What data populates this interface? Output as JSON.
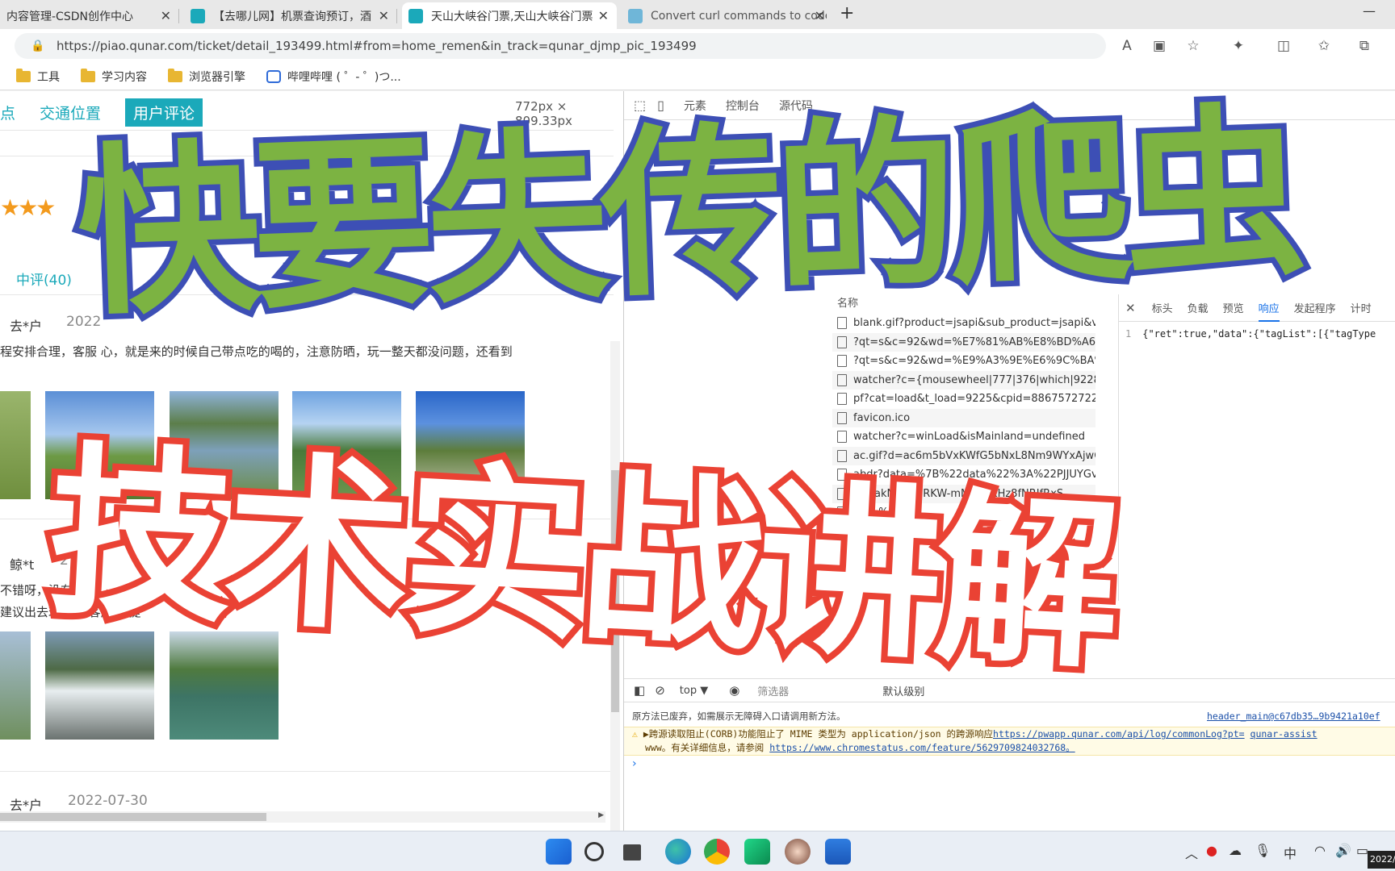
{
  "tabs": [
    {
      "title": "内容管理-CSDN创作中心",
      "close": "✕"
    },
    {
      "title": "【去哪儿网】机票查询预订，酒",
      "close": "✕"
    },
    {
      "title": "天山大峡谷门票,天山大峡谷门票",
      "close": "✕"
    },
    {
      "title": "Convert curl commands to code",
      "close": "✕"
    }
  ],
  "new_tab": "+",
  "window_minimize": "—",
  "address": {
    "url": "https://piao.qunar.com/ticket/detail_193499.html#from=home_remen&in_track=qunar_djmp_pic_193499"
  },
  "bookmarks": [
    "工具",
    "学习内容",
    "浏览器引擎",
    "哔哩哔哩 ( ゜- ゜)つ..."
  ],
  "page": {
    "nav": [
      "点",
      "交通位置",
      "用户评论"
    ],
    "dimensions": "772px × 809.33px",
    "stars": "★★★",
    "filter_label": "中评(40)",
    "reviews": [
      {
        "user": "去*户",
        "date": "2022",
        "text": "程安排合理，客服      心，就是来的时候自己带点吃的喝的，注意防晒，玩一整天都没问题，还看到"
      },
      {
        "user": "鲸*t",
        "date": "2",
        "text1": "不错呀，没有",
        "text2": "建议出去玩的时        客服             就提"
      },
      {
        "user": "去*户",
        "date": "2022-07-30"
      }
    ]
  },
  "devtools": {
    "tabs": [
      "元素",
      "控制台",
      "源代码"
    ],
    "req_header": "名称",
    "requests": [
      "blank.gif?product=jsapi&sub_product=jsapi&v=2.0...",
      "?qt=s&c=92&wd=%E7%81%AB%E8%BD%A6%E7%...",
      "?qt=s&c=92&wd=%E9%A3%9E%E6%9C%BA%E5%9...",
      "watcher?c={mousewheel|777|376|which|9228.09999...",
      "pf?cat=load&t_load=9225&cpid=88675727224d488...",
      "favicon.ico",
      "watcher?c=winLoad&isMainland=undefined",
      "ac.gif?d=ac6m5bVxKWfG5bNxL8Nm9WYxAjwG5Xw...",
      "abdr?data=%7B%22data%22%3A%22PJJUYGv4kqUl...",
      "?d=akN...5fNRKW-mM8NiJXHz8fNRJfRxS...",
      "a=...%22Q..."
    ],
    "detail_tabs": [
      "标头",
      "负载",
      "预览",
      "响应",
      "发起程序",
      "计时"
    ],
    "active_detail": "响应",
    "response_line": "1",
    "response_text": "{\"ret\":true,\"data\":{\"tagList\":[{\"tagType",
    "console": {
      "context": "top ▼",
      "filter_placeholder": "筛选器",
      "level": "默认级别",
      "msg1": "原方法已废弃，如需展示无障碍入口请调用新方法。",
      "msg1_source": "header_main@c67db35…9b9421a10ef",
      "warn_prefix": "▶跨源读取阻止(CORB)功能阻止了 MIME 类型为 application/json 的跨源响应",
      "warn_link1": "https://pwapp.qunar.com/api/log/commonLog?pt=",
      "warn_source": "qunar-assist",
      "warn_line2_prefix": "www。有关详细信息，请参阅",
      "warn_link2": "https://www.chromestatus.com/feature/5629709824032768。",
      "prompt": "›"
    }
  },
  "overlay": {
    "line1": "快要失传的爬虫",
    "line2": "技术实战讲解"
  },
  "taskbar": {
    "tray_ime": "中",
    "clock": "2022/"
  },
  "colors": {
    "accent_teal": "#1ba9ba",
    "overlay1_fill": "#7cb342",
    "overlay1_stroke": "#3d4fb5",
    "overlay2_fill": "#ffffff",
    "overlay2_stroke": "#ea4234"
  }
}
